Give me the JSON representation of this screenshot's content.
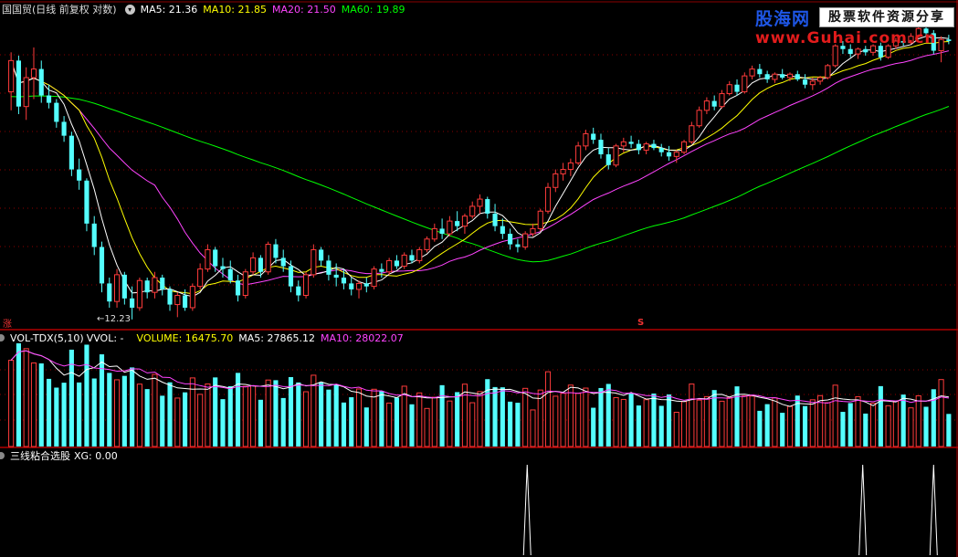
{
  "header": {
    "stock_title": "国国贸(日线 前复权 对数)",
    "ma": [
      {
        "label": "MA5: 21.36",
        "color": "#ffffff"
      },
      {
        "label": "MA10: 21.85",
        "color": "#ffff00"
      },
      {
        "label": "MA20: 21.50",
        "color": "#ff44ff"
      },
      {
        "label": "MA60: 19.89",
        "color": "#00ff00"
      }
    ]
  },
  "logo": {
    "brand": "股海网",
    "tagline": "股票软件资源分享",
    "url": "www.Guhai.com.cn"
  },
  "price_panel": {
    "low_marker": "←12.23",
    "zhang_badge": "涨",
    "s_marker": "S",
    "colors": {
      "up": "#ff3b3b",
      "down": "#54ffff",
      "grid": "#8b0000"
    },
    "candles": [
      [
        21.8,
        24.1,
        20.8,
        23.6
      ],
      [
        23.6,
        23.9,
        20.6,
        21.0
      ],
      [
        21.0,
        23.2,
        20.3,
        22.6
      ],
      [
        22.6,
        24.4,
        21.4,
        23.1
      ],
      [
        23.1,
        23.6,
        21.2,
        21.6
      ],
      [
        21.6,
        22.2,
        20.9,
        21.2
      ],
      [
        21.2,
        21.4,
        19.9,
        20.2
      ],
      [
        20.2,
        20.5,
        19.2,
        19.5
      ],
      [
        19.5,
        19.7,
        17.6,
        17.9
      ],
      [
        17.9,
        18.4,
        17.0,
        17.4
      ],
      [
        17.4,
        17.5,
        15.3,
        15.6
      ],
      [
        15.6,
        15.9,
        14.4,
        14.7
      ],
      [
        14.7,
        14.9,
        13.1,
        13.4
      ],
      [
        13.4,
        13.6,
        12.6,
        12.8
      ],
      [
        12.8,
        13.9,
        12.6,
        13.7
      ],
      [
        13.7,
        13.8,
        12.7,
        12.9
      ],
      [
        12.9,
        13.3,
        12.23,
        12.6
      ],
      [
        12.6,
        13.6,
        12.5,
        13.5
      ],
      [
        13.5,
        13.6,
        12.9,
        13.1
      ],
      [
        13.1,
        13.8,
        12.9,
        13.6
      ],
      [
        13.6,
        13.7,
        13.0,
        13.2
      ],
      [
        13.2,
        13.3,
        12.5,
        12.7
      ],
      [
        12.7,
        13.1,
        12.3,
        13.0
      ],
      [
        13.0,
        13.2,
        12.5,
        12.6
      ],
      [
        12.6,
        13.4,
        12.5,
        13.3
      ],
      [
        13.3,
        14.1,
        13.2,
        13.9
      ],
      [
        13.9,
        14.8,
        13.8,
        14.6
      ],
      [
        14.6,
        14.7,
        13.8,
        14.0
      ],
      [
        14.0,
        14.3,
        13.6,
        13.9
      ],
      [
        13.9,
        14.2,
        13.4,
        13.5
      ],
      [
        13.5,
        13.7,
        12.8,
        13.0
      ],
      [
        13.0,
        13.9,
        12.9,
        13.8
      ],
      [
        13.8,
        14.5,
        13.7,
        14.3
      ],
      [
        14.3,
        14.4,
        13.6,
        13.8
      ],
      [
        13.8,
        14.9,
        13.7,
        14.8
      ],
      [
        14.8,
        15.0,
        14.1,
        14.3
      ],
      [
        14.3,
        14.6,
        13.8,
        14.0
      ],
      [
        14.0,
        14.2,
        13.1,
        13.3
      ],
      [
        13.3,
        13.5,
        12.8,
        13.0
      ],
      [
        13.0,
        13.8,
        12.9,
        13.7
      ],
      [
        13.7,
        14.8,
        13.6,
        14.6
      ],
      [
        14.6,
        14.7,
        14.0,
        14.2
      ],
      [
        14.2,
        14.4,
        13.5,
        13.7
      ],
      [
        13.7,
        14.1,
        13.3,
        13.6
      ],
      [
        13.6,
        13.9,
        13.2,
        13.4
      ],
      [
        13.4,
        13.6,
        13.0,
        13.2
      ],
      [
        13.2,
        13.5,
        12.9,
        13.4
      ],
      [
        13.4,
        13.6,
        13.1,
        13.3
      ],
      [
        13.3,
        14.0,
        13.2,
        13.9
      ],
      [
        13.9,
        14.1,
        13.6,
        13.8
      ],
      [
        13.8,
        14.3,
        13.7,
        14.2
      ],
      [
        14.2,
        14.4,
        13.9,
        14.0
      ],
      [
        14.0,
        14.5,
        13.9,
        14.4
      ],
      [
        14.4,
        14.6,
        14.1,
        14.2
      ],
      [
        14.2,
        14.7,
        14.1,
        14.6
      ],
      [
        14.6,
        15.1,
        14.5,
        15.0
      ],
      [
        15.0,
        15.6,
        14.9,
        15.4
      ],
      [
        15.4,
        15.8,
        15.0,
        15.2
      ],
      [
        15.2,
        15.9,
        15.1,
        15.7
      ],
      [
        15.7,
        16.1,
        15.3,
        15.5
      ],
      [
        15.5,
        16.0,
        15.2,
        15.9
      ],
      [
        15.9,
        16.5,
        15.8,
        16.3
      ],
      [
        16.3,
        16.8,
        16.0,
        16.6
      ],
      [
        16.6,
        16.7,
        15.8,
        16.0
      ],
      [
        16.0,
        16.4,
        15.3,
        15.5
      ],
      [
        15.5,
        15.8,
        15.0,
        15.2
      ],
      [
        15.2,
        15.4,
        14.6,
        14.8
      ],
      [
        14.8,
        15.0,
        14.5,
        14.7
      ],
      [
        14.7,
        15.3,
        14.6,
        15.2
      ],
      [
        15.2,
        15.6,
        15.1,
        15.4
      ],
      [
        15.4,
        16.2,
        15.3,
        16.1
      ],
      [
        16.1,
        17.3,
        16.0,
        17.1
      ],
      [
        17.1,
        17.9,
        16.9,
        17.7
      ],
      [
        17.7,
        18.2,
        17.4,
        17.9
      ],
      [
        17.9,
        18.4,
        17.6,
        18.2
      ],
      [
        18.2,
        19.2,
        18.1,
        19.0
      ],
      [
        19.0,
        19.8,
        18.8,
        19.6
      ],
      [
        19.6,
        19.9,
        19.1,
        19.3
      ],
      [
        19.3,
        19.6,
        18.4,
        18.6
      ],
      [
        18.6,
        18.9,
        17.9,
        18.1
      ],
      [
        18.1,
        19.1,
        18.0,
        19.0
      ],
      [
        19.0,
        19.4,
        18.7,
        19.2
      ],
      [
        19.2,
        19.5,
        18.9,
        19.1
      ],
      [
        19.1,
        19.3,
        18.6,
        18.8
      ],
      [
        18.8,
        19.2,
        18.6,
        19.1
      ],
      [
        19.1,
        19.3,
        18.8,
        18.9
      ],
      [
        18.9,
        19.1,
        18.5,
        18.7
      ],
      [
        18.7,
        19.0,
        18.3,
        18.5
      ],
      [
        18.5,
        18.8,
        18.2,
        18.7
      ],
      [
        18.7,
        19.3,
        18.6,
        19.2
      ],
      [
        19.2,
        20.2,
        19.1,
        20.0
      ],
      [
        20.0,
        21.0,
        19.9,
        20.8
      ],
      [
        20.8,
        21.5,
        20.6,
        21.3
      ],
      [
        21.3,
        21.6,
        20.8,
        21.0
      ],
      [
        21.0,
        21.9,
        20.9,
        21.7
      ],
      [
        21.7,
        22.4,
        21.6,
        22.2
      ],
      [
        22.2,
        22.5,
        21.6,
        21.8
      ],
      [
        21.8,
        22.9,
        21.7,
        22.7
      ],
      [
        22.7,
        23.3,
        22.5,
        23.1
      ],
      [
        23.1,
        23.4,
        22.6,
        22.8
      ],
      [
        22.8,
        23.0,
        22.3,
        22.5
      ],
      [
        22.5,
        22.9,
        22.3,
        22.8
      ],
      [
        22.8,
        23.1,
        22.5,
        22.6
      ],
      [
        22.6,
        22.9,
        22.4,
        22.8
      ],
      [
        22.8,
        23.0,
        22.4,
        22.5
      ],
      [
        22.5,
        22.8,
        22.0,
        22.2
      ],
      [
        22.2,
        22.6,
        21.9,
        22.4
      ],
      [
        22.4,
        22.7,
        22.2,
        22.6
      ],
      [
        22.6,
        23.4,
        22.5,
        23.3
      ],
      [
        23.3,
        24.6,
        23.2,
        24.5
      ],
      [
        24.5,
        24.8,
        24.0,
        24.3
      ],
      [
        24.3,
        24.6,
        23.8,
        24.0
      ],
      [
        24.0,
        24.4,
        23.7,
        24.3
      ],
      [
        24.3,
        24.5,
        23.9,
        24.1
      ],
      [
        24.1,
        24.6,
        23.9,
        24.5
      ],
      [
        24.5,
        24.7,
        23.6,
        23.8
      ],
      [
        23.8,
        24.6,
        23.7,
        24.5
      ],
      [
        24.5,
        25.0,
        24.3,
        24.8
      ],
      [
        24.8,
        25.1,
        24.5,
        24.7
      ],
      [
        24.7,
        25.3,
        24.6,
        25.1
      ],
      [
        25.1,
        25.9,
        25.0,
        25.6
      ],
      [
        25.6,
        26.2,
        25.1,
        25.3
      ],
      [
        25.3,
        25.5,
        24.0,
        24.2
      ],
      [
        24.2,
        25.1,
        23.5,
        24.9
      ],
      [
        24.9,
        25.2,
        24.6,
        24.8
      ]
    ],
    "price_range": [
      12.0,
      26.4
    ]
  },
  "volume_panel": {
    "title": "VOL-TDX(5,10)",
    "vvol": "VVOL: -",
    "volume": "VOLUME: 16475.70",
    "ma5": "MA5: 27865.12",
    "ma10": "MA10: 28022.07",
    "colors": {
      "title": "#ffffff",
      "volume": "#ffff00",
      "ma5": "#ffffff",
      "ma10": "#ff44ff"
    }
  },
  "xg_panel": {
    "title": "三线粘合选股",
    "xg": "XG: 0.00",
    "signals": [
      110,
      181,
      196
    ]
  }
}
